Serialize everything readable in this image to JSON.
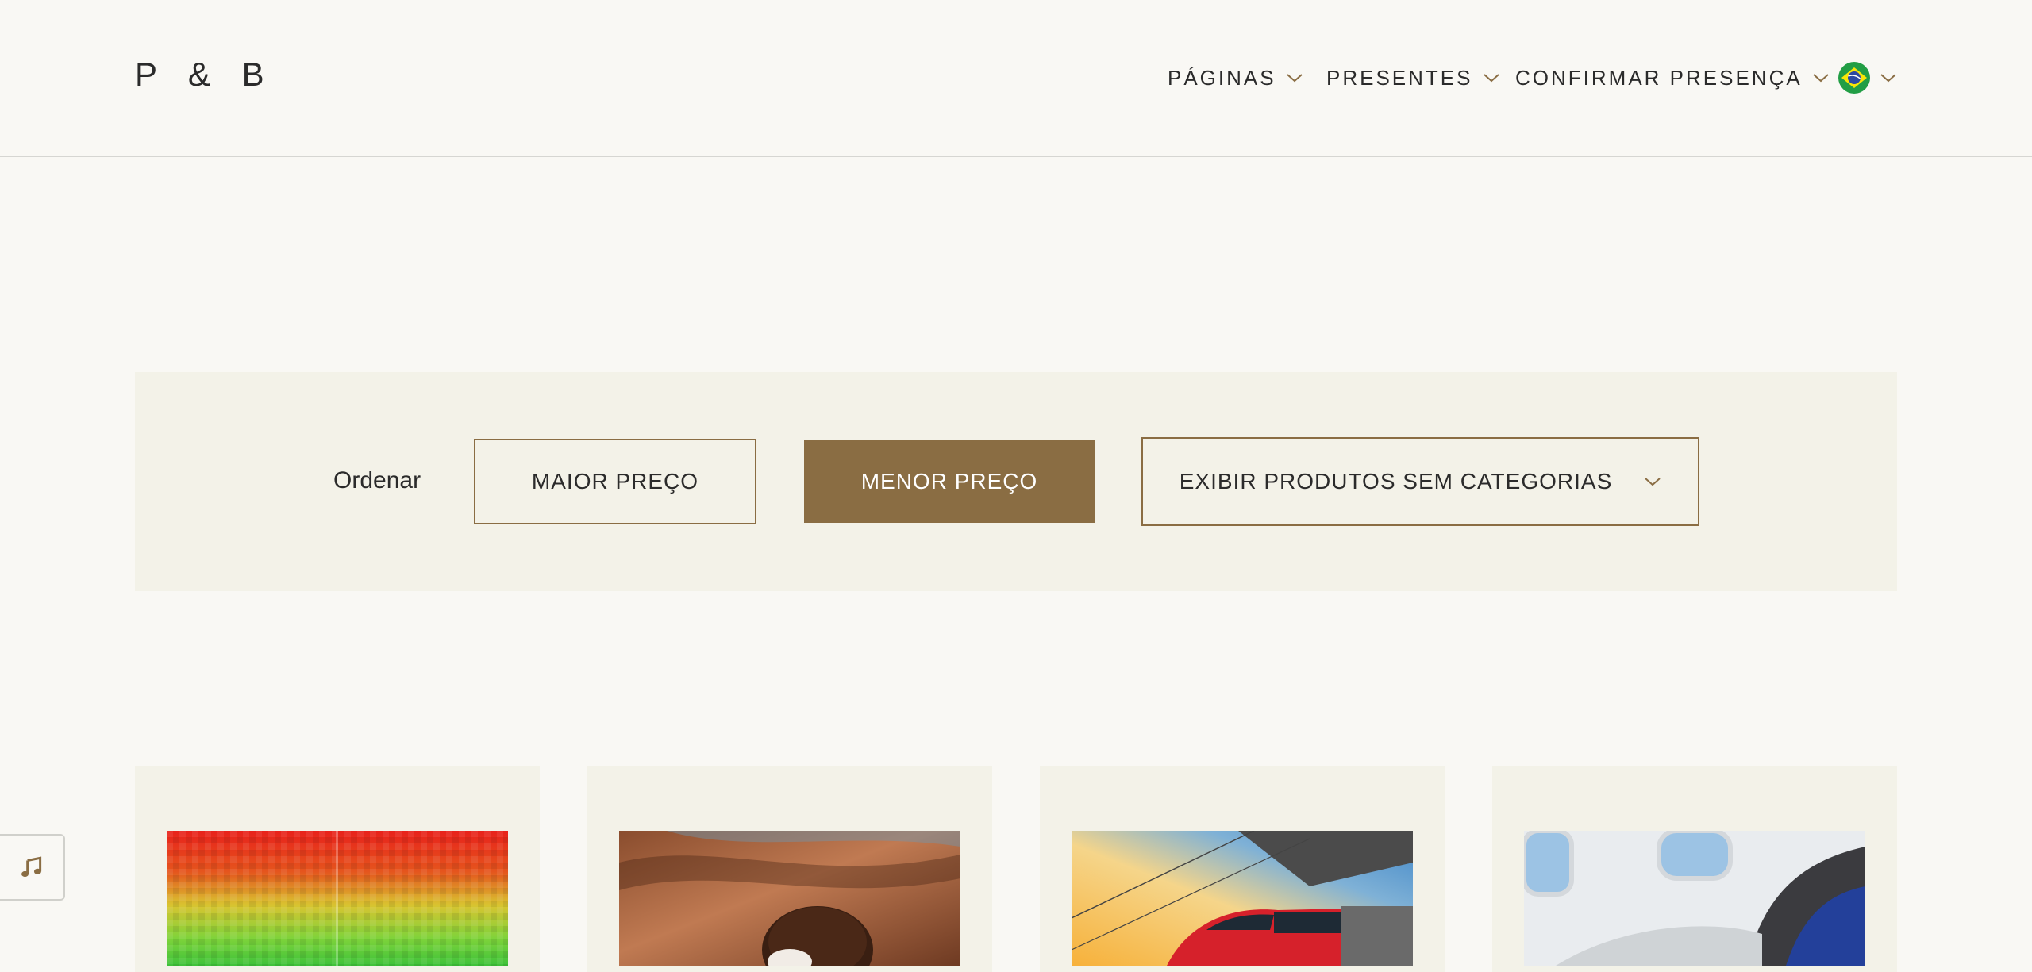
{
  "header": {
    "logo": "P & B",
    "nav": [
      {
        "label": "PÁGINAS"
      },
      {
        "label": "PRESENTES"
      },
      {
        "label": "CONFIRMAR PRESENÇA"
      }
    ],
    "language_flag": "brazil-flag-icon"
  },
  "filters": {
    "sort_label": "Ordenar",
    "sort_highest": "MAIOR PREÇO",
    "sort_lowest": "MENOR PREÇO",
    "category_select": "EXIBIR PRODUTOS SEM CATEGORIAS",
    "active_sort": "MENOR PREÇO"
  },
  "products": [
    {
      "image": "colorful-abstract-image"
    },
    {
      "image": "chocolate-brigadeiro-image"
    },
    {
      "image": "red-train-image"
    },
    {
      "image": "airplane-cabin-image"
    }
  ],
  "music_button_icon": "music-note-icon",
  "colors": {
    "accent": "#8a6d43",
    "background": "#f9f8f4",
    "panel": "#f3f2e8",
    "text": "#2b2b2b"
  }
}
